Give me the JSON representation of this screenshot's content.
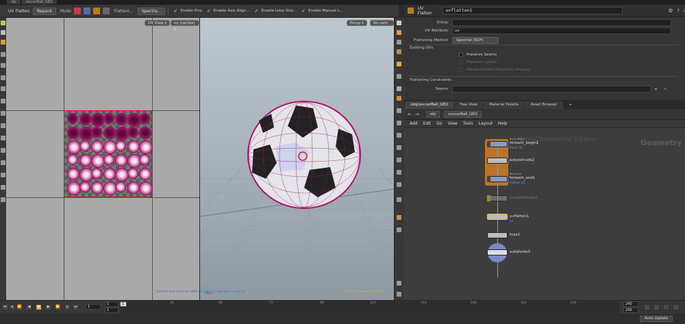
{
  "top_tabs": [
    "obj",
    "soccerBall_GEO"
  ],
  "toolbar": {
    "title": "UV Flatten",
    "repack_label": "Repack",
    "mode_label": "Mode",
    "flatten_label": "Flatteni...",
    "flatten_method_value": "Spectra...",
    "checks": [
      "Enable Pins",
      "Enable Axis Align...",
      "Enable Loop Stra...",
      "Enable Manual L..."
    ],
    "check_mark": "✓"
  },
  "uv_view": {
    "menu_uvview": "UV View ▾",
    "menu_uvvertex": "uv (vertex) ▾"
  },
  "view3d": {
    "persp_label": "Persp ▾",
    "cam_label": "No cam ▾",
    "status_message": "Select the pins or left-click on a vertex to pin it.",
    "watermark": "Non-Commercial Edition"
  },
  "params": {
    "node_type": "UV Flatten",
    "node_name": "uvflatten1",
    "rows": {
      "group_label": "Group",
      "group_value": "",
      "uvattr_label": "UV Attribute",
      "uvattr_value": "uv",
      "method_label": "Flattening Method",
      "method_value": "Spectral (SCP)"
    },
    "existing_uvs_title": "Existing UVs",
    "checks": [
      {
        "label": "Preserve Seams",
        "enabled": true
      },
      {
        "label": "Preserve Layout",
        "enabled": false
      },
      {
        "label": "Preserve Island Boundary Shapes",
        "enabled": false
      }
    ],
    "constraints_title": "Flattening Constraints",
    "seams_label": "Seams",
    "seams_value": ""
  },
  "network": {
    "tabs": [
      "/obj/soccerBall_GEO",
      "Tree View",
      "Material Palette",
      "Asset Browser",
      "+"
    ],
    "path_obj": "obj",
    "path_geo": "soccerBall_GEO",
    "menu": [
      "Add",
      "Edit",
      "Go",
      "View",
      "Tools",
      "Layout",
      "Help"
    ],
    "watermark_left": "Non-Commercial Edition",
    "watermark_right": "Geometry",
    "nodes": [
      {
        "name": "foreach_begin1",
        "sub": "Piece  31",
        "tiny": "Block Begin"
      },
      {
        "name": "polyextrude2",
        "sub": "",
        "tiny": ""
      },
      {
        "name": "foreach_end1",
        "sub": "Gather  32",
        "tiny": "Block End"
      },
      {
        "name": "uvquickshade1",
        "sub": "",
        "tiny": ""
      },
      {
        "name": "uvflatten1",
        "sub": "uv",
        "tiny": ""
      },
      {
        "name": "fuse1",
        "sub": "",
        "tiny": ""
      },
      {
        "name": "subdivide3",
        "sub": "",
        "tiny": ""
      }
    ]
  },
  "timeline": {
    "start_field": "1",
    "start_field2": "1",
    "current_frame": "1",
    "end_field": "240",
    "end_field2": "240",
    "ticks": [
      "24",
      "48",
      "72",
      "96",
      "120",
      "144",
      "168",
      "192",
      "216"
    ],
    "auto_update_label": "Auto Update"
  }
}
